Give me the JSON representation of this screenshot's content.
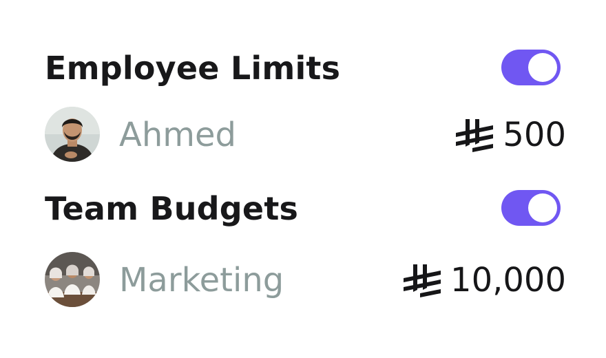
{
  "employee_limits": {
    "title": "Employee Limits",
    "toggle_on": true,
    "toggle_color": "#7057f2",
    "entry": {
      "name": "Ahmed",
      "currency_icon": "saudi-riyal-icon",
      "amount": "500"
    }
  },
  "team_budgets": {
    "title": "Team Budgets",
    "toggle_on": true,
    "toggle_color": "#7057f2",
    "entry": {
      "name": "Marketing",
      "currency_icon": "saudi-riyal-icon",
      "amount": "10,000"
    }
  }
}
